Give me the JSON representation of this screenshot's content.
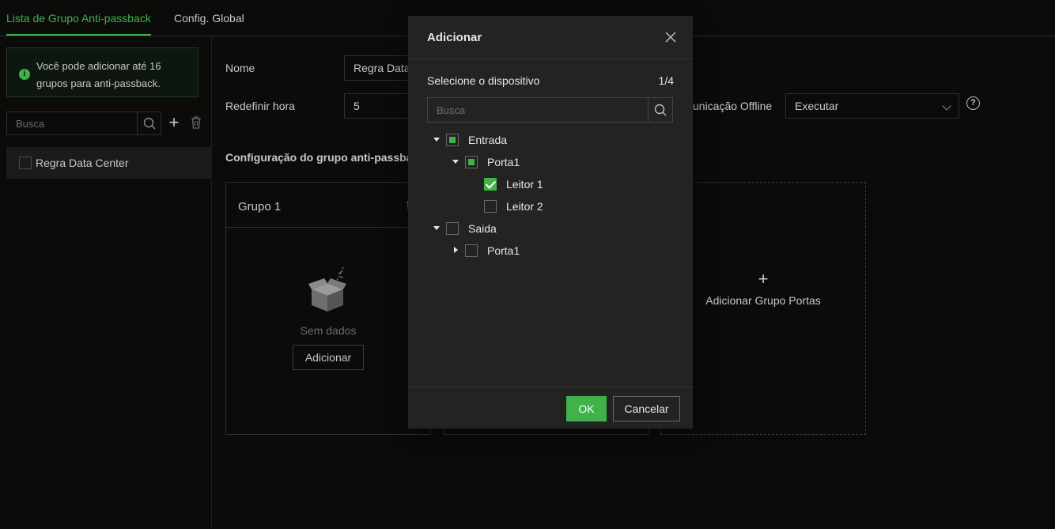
{
  "tabs": {
    "anti_passback_list": "Lista de Grupo Anti-passback",
    "global_config": "Config. Global"
  },
  "left": {
    "info": "Você pode adicionar até 16 grupos para anti-passback.",
    "search_placeholder": "Busca",
    "items": [
      {
        "label": "Regra Data Center",
        "checked": false
      }
    ]
  },
  "form": {
    "name_label": "Nome",
    "name_value": "Regra Data Center",
    "reset_label": "Redefinir hora",
    "reset_value": "5",
    "offline_label": "unicação Offline",
    "offline_value": "Executar",
    "section_title": "Configuração do grupo anti-passback"
  },
  "groups": [
    {
      "title": "Grupo 1",
      "empty_text": "Sem dados",
      "add_label": "Adicionar"
    }
  ],
  "add_door_group": {
    "label": "Adicionar Grupo Portas"
  },
  "modal": {
    "title": "Adicionar",
    "device_label": "Selecione o dispositivo",
    "device_count": "1/4",
    "search_placeholder": "Busca",
    "tree": [
      {
        "label": "Entrada",
        "state": "indeterminate",
        "expanded": true
      },
      {
        "label": "Porta1",
        "state": "indeterminate",
        "expanded": true
      },
      {
        "label": "Leitor 1",
        "state": "checked"
      },
      {
        "label": "Leitor 2",
        "state": "unchecked"
      },
      {
        "label": "Saida",
        "state": "unchecked",
        "expanded": true
      },
      {
        "label": "Porta1",
        "state": "unchecked",
        "expanded": false
      }
    ],
    "ok_label": "OK",
    "cancel_label": "Cancelar"
  },
  "colors": {
    "accent": "#3fb24a",
    "background": "#0b0c0a",
    "modal_bg": "#232422"
  }
}
